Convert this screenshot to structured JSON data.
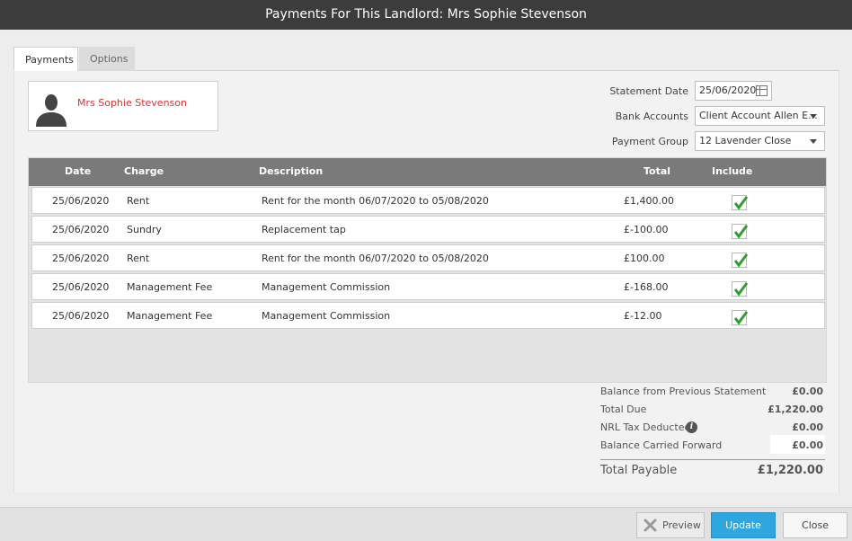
{
  "window": {
    "title": "Payments For This Landlord: Mrs Sophie Stevenson"
  },
  "tabs": [
    {
      "label": "Payments",
      "active": true
    },
    {
      "label": "Options",
      "active": false
    }
  ],
  "landlord": {
    "name": "Mrs Sophie Stevenson",
    "icon": "person-silhouette-icon"
  },
  "fields": {
    "statement_date": {
      "label": "Statement Date",
      "value": "25/06/2020"
    },
    "bank_accounts": {
      "label": "Bank Accounts",
      "value": "Client Account Allen E..."
    },
    "payment_group": {
      "label": "Payment Group",
      "value": "12 Lavender Close"
    }
  },
  "table": {
    "columns": [
      "Date",
      "Charge",
      "Description",
      "Total",
      "Include"
    ],
    "rows": [
      {
        "date": "25/06/2020",
        "charge": "Rent",
        "description": "Rent for the month 06/07/2020 to 05/08/2020",
        "total": "£1,400.00",
        "include": true
      },
      {
        "date": "25/06/2020",
        "charge": "Sundry",
        "description": "Replacement tap",
        "total": "£-100.00",
        "include": true
      },
      {
        "date": "25/06/2020",
        "charge": "Rent",
        "description": "Rent for the month 06/07/2020 to 05/08/2020",
        "total": "£100.00",
        "include": true
      },
      {
        "date": "25/06/2020",
        "charge": "Management Fee",
        "description": "Management Commission",
        "total": "£-168.00",
        "include": true
      },
      {
        "date": "25/06/2020",
        "charge": "Management Fee",
        "description": "Management Commission",
        "total": "£-12.00",
        "include": true
      }
    ]
  },
  "summary": {
    "balance_previous": {
      "label": "Balance from Previous Statement",
      "value": "£0.00"
    },
    "total_due": {
      "label": "Total Due",
      "value": "£1,220.00"
    },
    "nrl_tax": {
      "label": "NRL Tax Deducted",
      "value": "£0.00"
    },
    "balance_carried": {
      "label": "Balance Carried Forward",
      "value": "£0.00"
    },
    "total_payable": {
      "label": "Total Payable",
      "value": "£1,220.00"
    }
  },
  "buttons": {
    "preview": "Preview",
    "update": "Update",
    "close": "Close"
  },
  "colors": {
    "titlebar": "#3c3c3c",
    "accent": "#2ea7e0",
    "landlord_name": "#dd3333",
    "check": "#2e9e2e"
  }
}
